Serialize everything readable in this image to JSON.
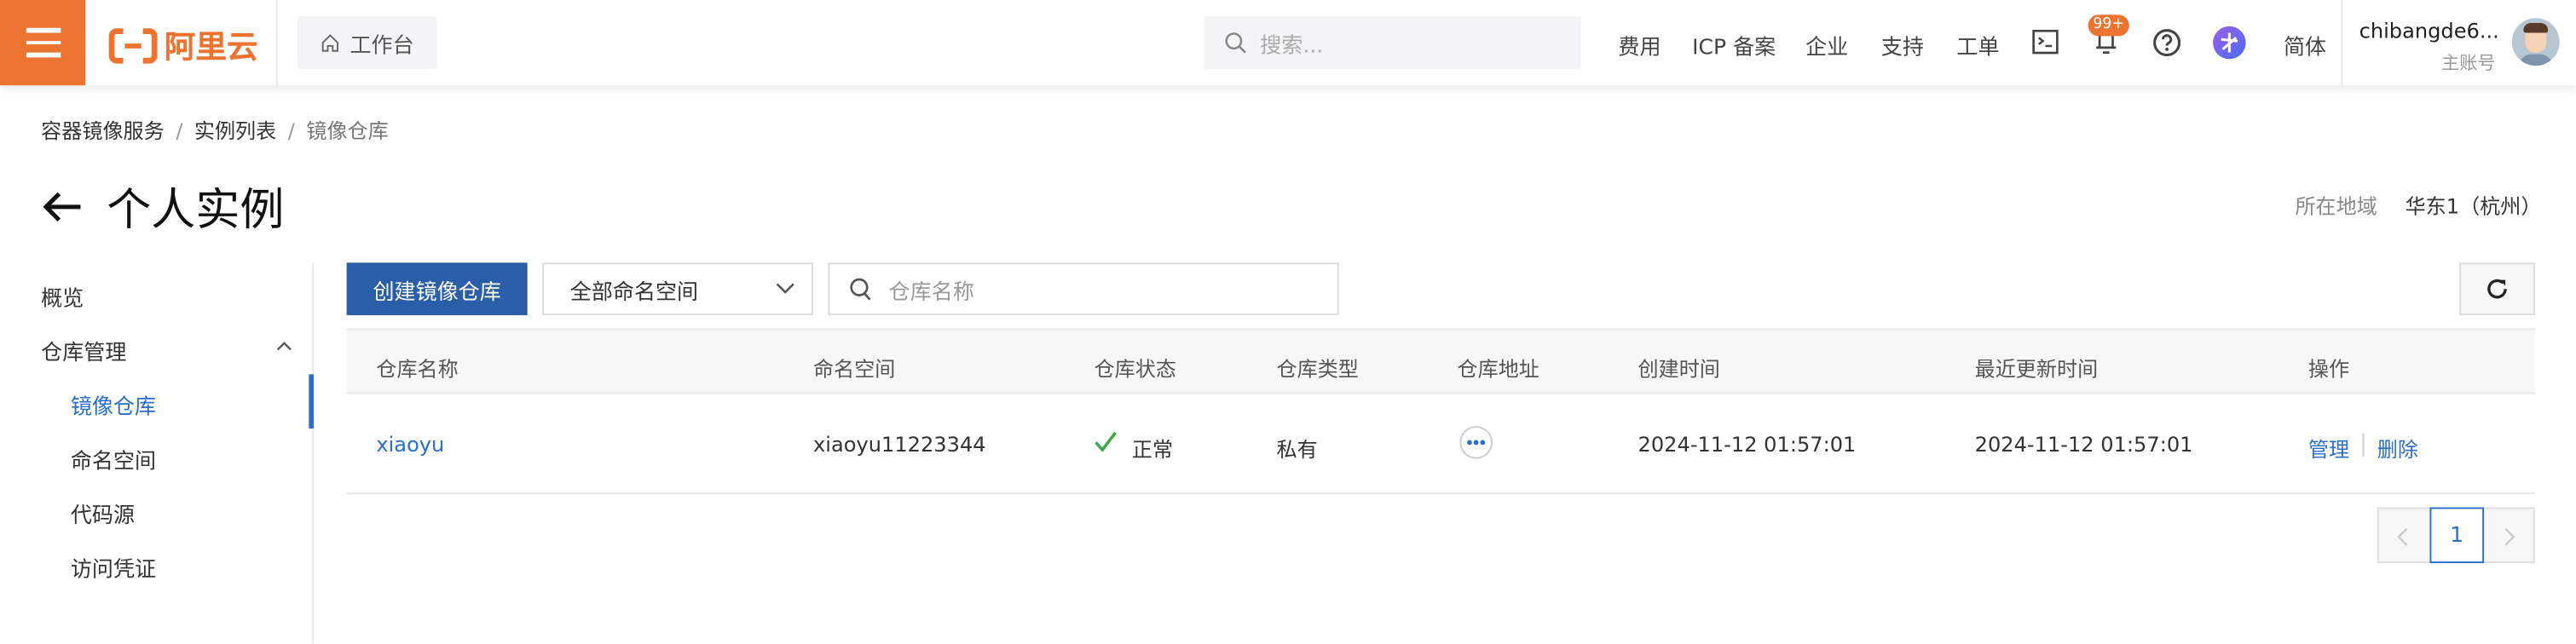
{
  "header": {
    "logo_text": "阿里云",
    "workbench": "工作台",
    "search_placeholder": "搜索...",
    "nav": [
      "费用",
      "ICP 备案",
      "企业",
      "支持",
      "工单"
    ],
    "notification_badge": "99+",
    "language": "简体",
    "user_name": "chibangde6...",
    "account_type": "主账号"
  },
  "breadcrumb": [
    "容器镜像服务",
    "实例列表",
    "镜像仓库"
  ],
  "page_title": "个人实例",
  "region": {
    "label": "所在地域",
    "value": "华东1（杭州）"
  },
  "sidebar": {
    "overview": "概览",
    "group": "仓库管理",
    "items": [
      "镜像仓库",
      "命名空间",
      "代码源",
      "访问凭证"
    ]
  },
  "toolbar": {
    "create_button": "创建镜像仓库",
    "namespace_select": "全部命名空间",
    "search_placeholder": "仓库名称"
  },
  "table": {
    "columns": [
      "仓库名称",
      "命名空间",
      "仓库状态",
      "仓库类型",
      "仓库地址",
      "创建时间",
      "最近更新时间",
      "操作"
    ],
    "rows": [
      {
        "name": "xiaoyu",
        "namespace": "xiaoyu11223344",
        "status": "正常",
        "type": "私有",
        "created": "2024-11-12 01:57:01",
        "updated": "2024-11-12 01:57:01",
        "actions": [
          "管理",
          "删除"
        ]
      }
    ]
  },
  "pagination": {
    "current": "1"
  },
  "colors": {
    "brand": "#ed7430",
    "primary": "#2a5ea8",
    "link": "#2a6fcc",
    "success": "#3aa845"
  }
}
